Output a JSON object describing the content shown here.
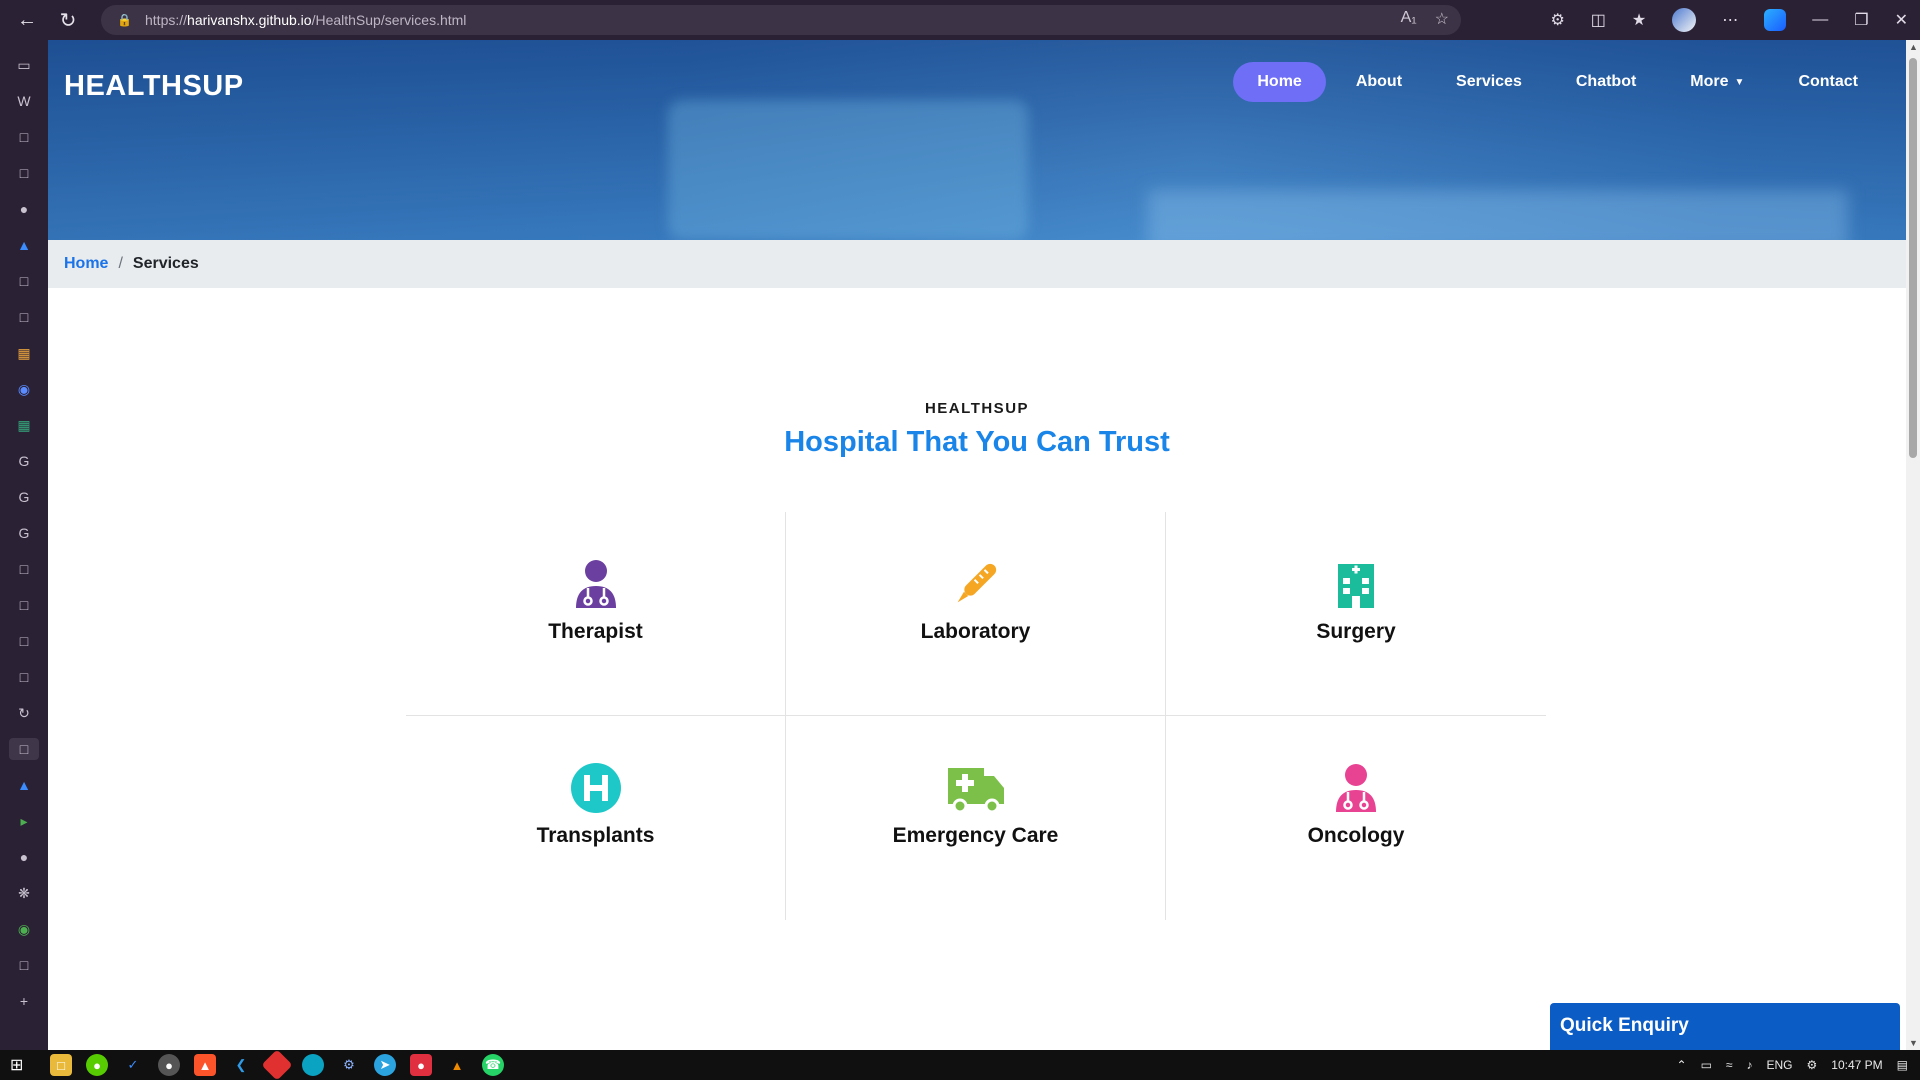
{
  "browser": {
    "url_prefix": "https://",
    "url_host": "harivanshx.github.io",
    "url_path": "/HealthSup/services.html"
  },
  "site": {
    "brand": "HEALTHSUP",
    "nav": [
      {
        "label": "Home"
      },
      {
        "label": "About"
      },
      {
        "label": "Services"
      },
      {
        "label": "Chatbot"
      },
      {
        "label": "More"
      },
      {
        "label": "Contact"
      }
    ]
  },
  "breadcrumb": {
    "home": "Home",
    "separator": "/",
    "current": "Services"
  },
  "section": {
    "eyebrow": "HEALTHSUP",
    "headline": "Hospital That You Can Trust"
  },
  "services": [
    {
      "title": "Therapist",
      "icon": "doctor-icon",
      "color": "#6b3fa0"
    },
    {
      "title": "Laboratory",
      "icon": "thermometer-icon",
      "color": "#f5a623"
    },
    {
      "title": "Surgery",
      "icon": "hospital-building-icon",
      "color": "#1abc9c"
    },
    {
      "title": "Transplants",
      "icon": "hospital-h-icon",
      "color": "#1ec8c8"
    },
    {
      "title": "Emergency Care",
      "icon": "ambulance-icon",
      "color": "#7cc04a"
    },
    {
      "title": "Oncology",
      "icon": "doctor-icon",
      "color": "#e84393"
    }
  ],
  "enquiry": {
    "label": "Quick Enquiry"
  },
  "taskbar": {
    "language": "ENG",
    "time": "10:47 PM"
  },
  "colors": {
    "accent": "#1a85e8",
    "nav_active": "#6f6ef7",
    "enquiry": "#0b5cc4"
  }
}
